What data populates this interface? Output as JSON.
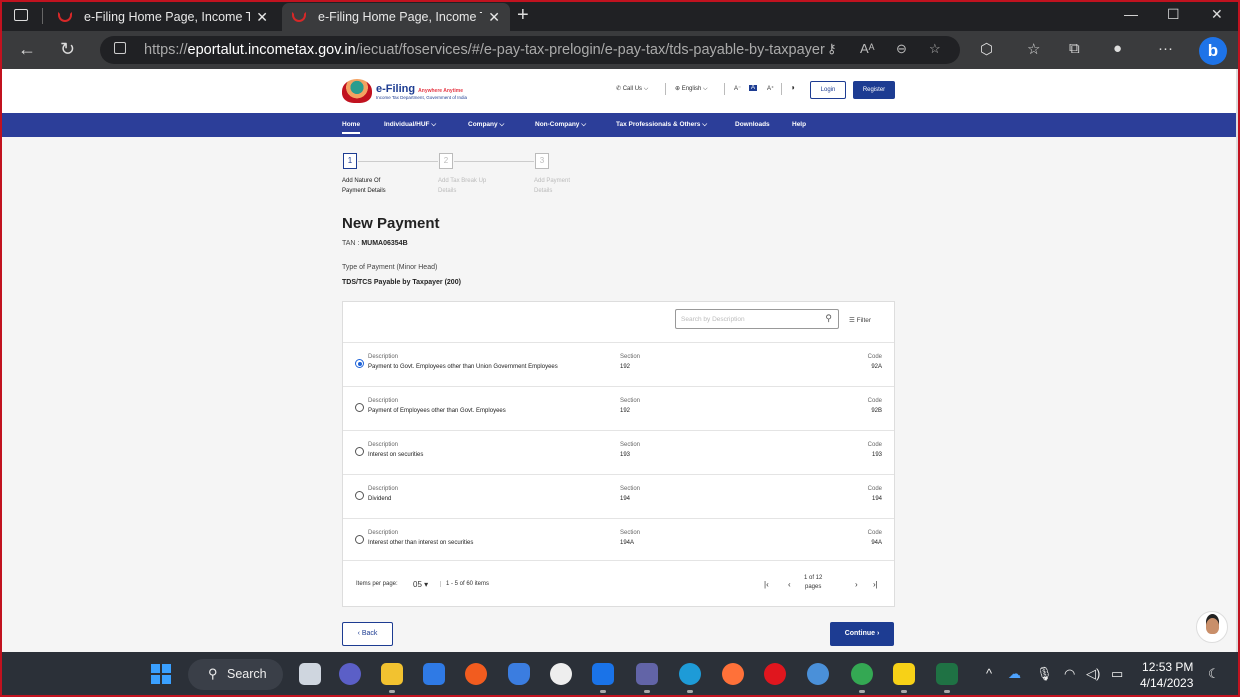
{
  "browser": {
    "tabs": [
      {
        "title": "e-Filing Home Page, Income Tax"
      },
      {
        "title": "e-Filing Home Page, Income Tax"
      }
    ],
    "url_prefix": "https://",
    "url_domain": "eportalut.incometax.gov.in",
    "url_path": "/iecuat/foservices/#/e-pay-tax-prelogin/e-pay-tax/tds-payable-by-taxpayer"
  },
  "site": {
    "logo_title": "e-Filing",
    "logo_tagline": "Anywhere Anytime",
    "logo_subtitle": "Income Tax Department, Government of India",
    "call_us": "Call Us",
    "language": "English",
    "font_small": "A",
    "font_normal": "A",
    "font_large": "A",
    "contrast": "◑",
    "login": "Login",
    "register": "Register"
  },
  "nav": {
    "home": "Home",
    "individual": "Individual/HUF",
    "company": "Company",
    "non_company": "Non-Company",
    "tax_professionals": "Tax Professionals & Others",
    "downloads": "Downloads",
    "help": "Help"
  },
  "stepper": [
    {
      "num": "1",
      "label": "Add Nature Of Payment Details"
    },
    {
      "num": "2",
      "label": "Add Tax Break Up Details"
    },
    {
      "num": "3",
      "label": "Add Payment Details"
    }
  ],
  "form": {
    "title": "New Payment",
    "tan_label": "TAN :",
    "tan_value": "MUMA06354B",
    "type_label": "Type of Payment (Minor Head)",
    "type_value": "TDS/TCS Payable by Taxpayer (200)"
  },
  "table": {
    "search_placeholder": "Search by Description",
    "filter_label": "Filter",
    "header_desc": "Description",
    "header_section": "Section",
    "header_code": "Code",
    "rows": [
      {
        "desc": "Payment to Govt. Employees other than Union Government Employees",
        "section": "192",
        "code": "92A",
        "selected": true
      },
      {
        "desc": "Payment of Employees other than Govt. Employees",
        "section": "192",
        "code": "92B",
        "selected": false
      },
      {
        "desc": "Interest on securities",
        "section": "193",
        "code": "193",
        "selected": false
      },
      {
        "desc": "Dividend",
        "section": "194",
        "code": "194",
        "selected": false
      },
      {
        "desc": "Interest other than interest on securities",
        "section": "194A",
        "code": "94A",
        "selected": false
      }
    ],
    "items_per_page_label": "Items per page:",
    "items_per_page_value": "05",
    "range_text": "1 - 5 of 60 items",
    "page_of_line1": "1 of 12",
    "page_of_line2": "pages"
  },
  "actions": {
    "back": "‹ Back",
    "continue": "Continue ›"
  },
  "taskbar": {
    "search": "Search",
    "time": "12:53 PM",
    "date": "4/14/2023"
  },
  "colors": {
    "brand_blue": "#1d3c92",
    "nav_blue": "#2c3e99",
    "radio_blue": "#1e63d8",
    "frame_red": "#c1121f"
  }
}
